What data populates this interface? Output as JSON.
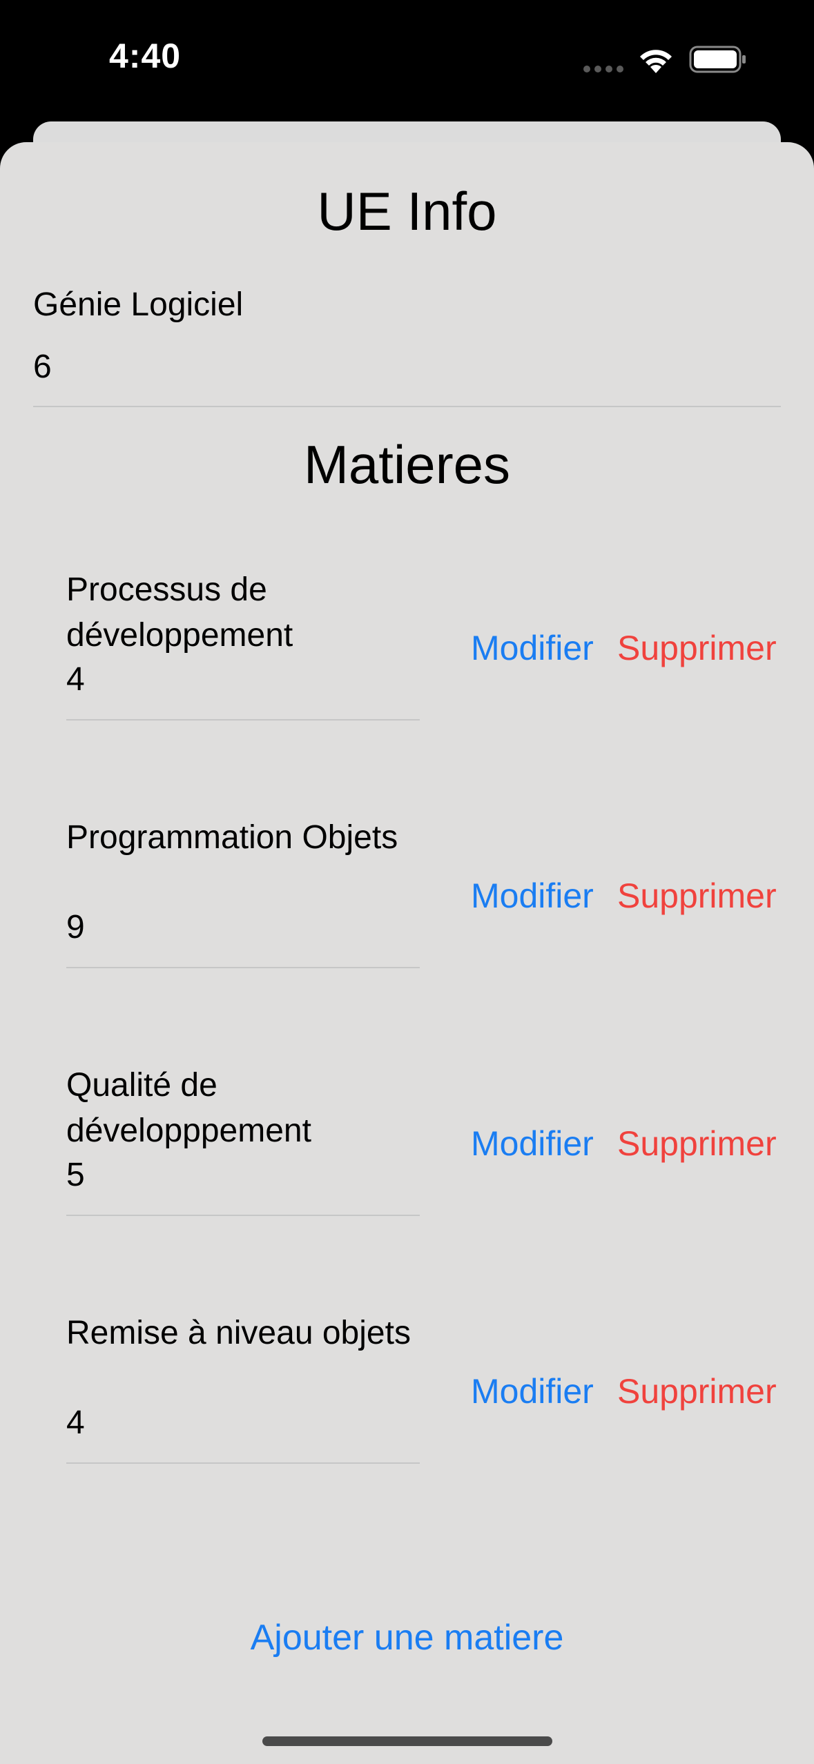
{
  "status_bar": {
    "time": "4:40"
  },
  "header": {
    "title": "UE Info"
  },
  "ue": {
    "name": "Génie Logiciel",
    "credits": "6"
  },
  "section": {
    "title": "Matieres"
  },
  "subjects": [
    {
      "name": "Processus de développement",
      "credits": "4"
    },
    {
      "name": "Programmation Objets",
      "credits": "9"
    },
    {
      "name": "Qualité de développpement",
      "credits": "5"
    },
    {
      "name": "Remise à niveau objets",
      "credits": "4"
    }
  ],
  "actions": {
    "modify_label": "Modifier",
    "delete_label": "Supprimer",
    "add_label": "Ajouter une matiere"
  },
  "colors": {
    "accent_blue": "#1a7df2",
    "destructive_red": "#f0423d",
    "sheet_background": "#dfdedd"
  },
  "icons": [
    "cellular-signal-icon",
    "wifi-icon",
    "battery-icon"
  ]
}
